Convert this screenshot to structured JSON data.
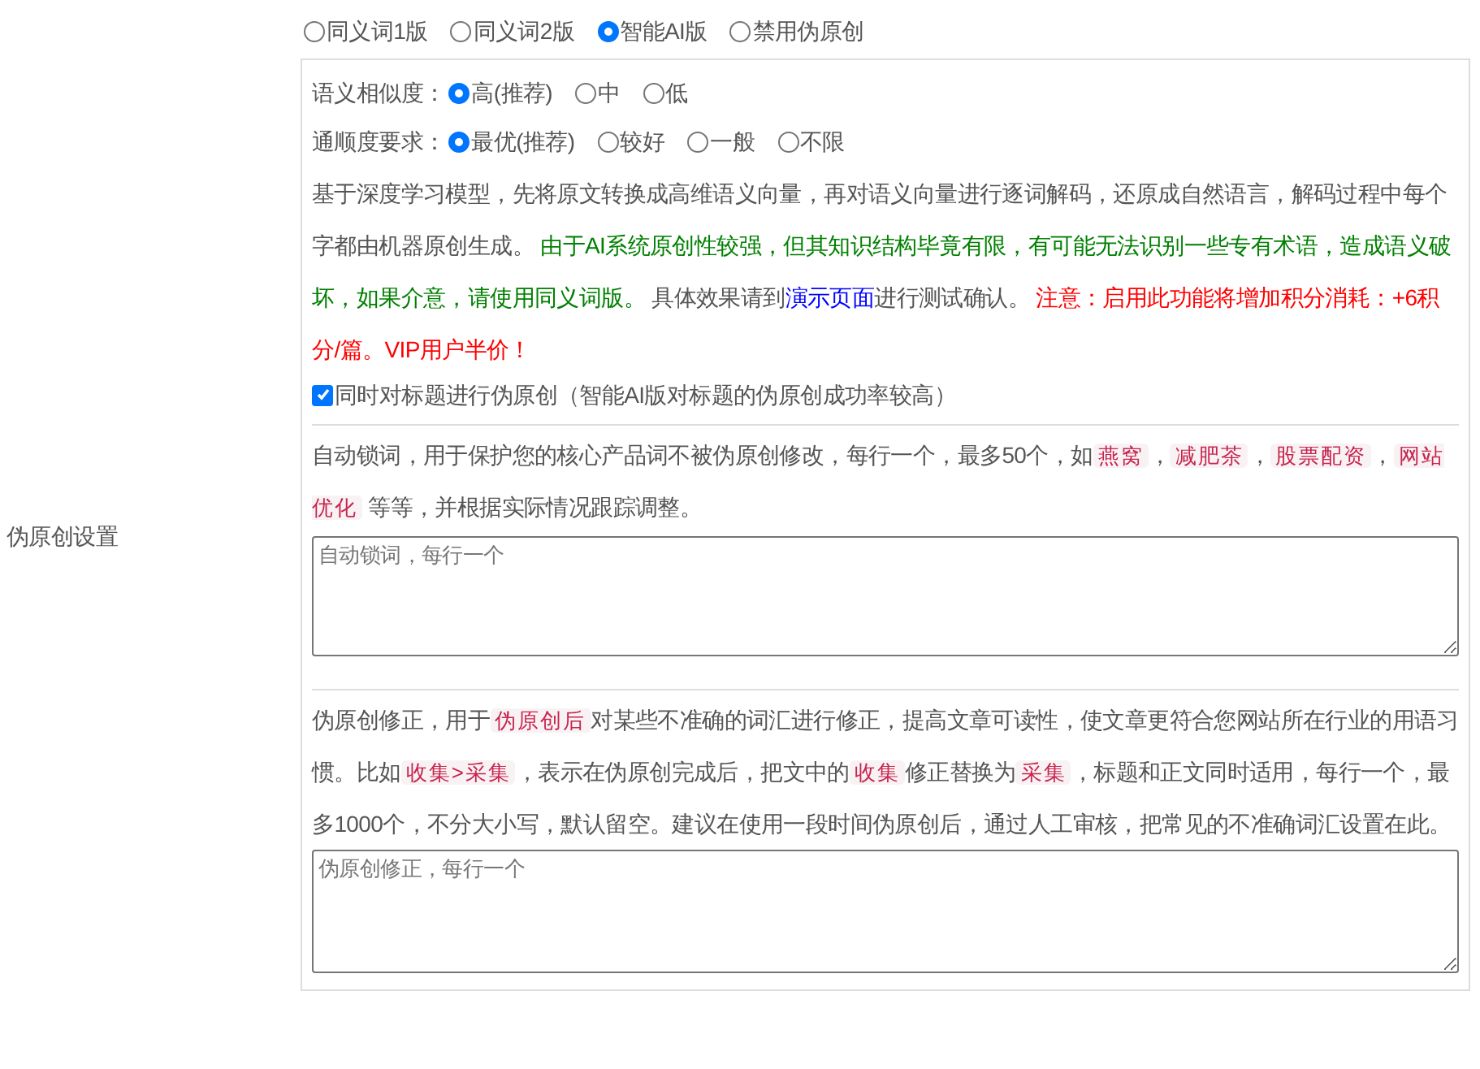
{
  "section_label": "伪原创设置",
  "modes": [
    {
      "label": "同义词1版",
      "selected": false
    },
    {
      "label": "同义词2版",
      "selected": false
    },
    {
      "label": "智能AI版",
      "selected": true
    },
    {
      "label": "禁用伪原创",
      "selected": false
    }
  ],
  "similarity": {
    "label": "语义相似度：",
    "options": [
      {
        "label": "高(推荐)",
        "selected": true
      },
      {
        "label": "中",
        "selected": false
      },
      {
        "label": "低",
        "selected": false
      }
    ]
  },
  "fluency": {
    "label": "通顺度要求：",
    "options": [
      {
        "label": "最优(推荐)",
        "selected": true
      },
      {
        "label": "较好",
        "selected": false
      },
      {
        "label": "一般",
        "selected": false
      },
      {
        "label": "不限",
        "selected": false
      }
    ]
  },
  "ai_description": [
    {
      "kind": "text",
      "text": "基于深度学习模型，先将原文转换成高维语义向量，再对语义向量进行逐词解码，还原成自然语言，解码过程中每个字都由机器原创生成。 ",
      "color": "#555555"
    },
    {
      "kind": "text",
      "text": "由于AI系统原创性较强，但其知识结构毕竟有限，有可能无法识别一些专有术语，造成语义破坏，如果介意，请使用同义词版。",
      "color": "#008000"
    },
    {
      "kind": "text",
      "text": " 具体效果请到",
      "color": "#555555"
    },
    {
      "kind": "link",
      "text": "演示页面",
      "color": "#0000ff"
    },
    {
      "kind": "text",
      "text": "进行测试确认。 ",
      "color": "#555555"
    },
    {
      "kind": "text",
      "text": "注意：启用此功能将增加积分消耗：+6积分/篇。VIP用户半价！",
      "color": "#ff0000"
    }
  ],
  "title_option": {
    "label": "同时对标题进行伪原创（智能AI版对标题的伪原创成功率较高）",
    "checked": true
  },
  "lock_words": {
    "description": [
      {
        "kind": "text",
        "text": "自动锁词，用于保护您的核心产品词不被伪原创修改，每行一个，最多50个，如"
      },
      {
        "kind": "code",
        "text": "燕窝"
      },
      {
        "kind": "text",
        "text": "，"
      },
      {
        "kind": "code",
        "text": "减肥茶"
      },
      {
        "kind": "text",
        "text": "，"
      },
      {
        "kind": "code",
        "text": "股票配资"
      },
      {
        "kind": "text",
        "text": "，"
      },
      {
        "kind": "code",
        "text": "网站优化"
      },
      {
        "kind": "text",
        "text": " 等等，并根据实际情况跟踪调整。"
      }
    ],
    "placeholder": "自动锁词，每行一个"
  },
  "corrections": {
    "description": [
      {
        "kind": "text",
        "text": "伪原创修正，用于"
      },
      {
        "kind": "code",
        "text": "伪原创后"
      },
      {
        "kind": "text",
        "text": "对某些不准确的词汇进行修正，提高文章可读性，使文章更符合您网站所在行业的用语习惯。比如"
      },
      {
        "kind": "code",
        "text": "收集>采集"
      },
      {
        "kind": "text",
        "text": "，表示在伪原创完成后，把文中的"
      },
      {
        "kind": "code",
        "text": "收集"
      },
      {
        "kind": "text",
        "text": "修正替换为"
      },
      {
        "kind": "code",
        "text": "采集"
      },
      {
        "kind": "text",
        "text": "，标题和正文同时适用，每行一个，最多1000个，不分大小写，默认留空。建议在使用一段时间伪原创后，通过人工审核，把常见的不准确词汇设置在此。"
      }
    ],
    "placeholder": "伪原创修正，每行一个"
  }
}
